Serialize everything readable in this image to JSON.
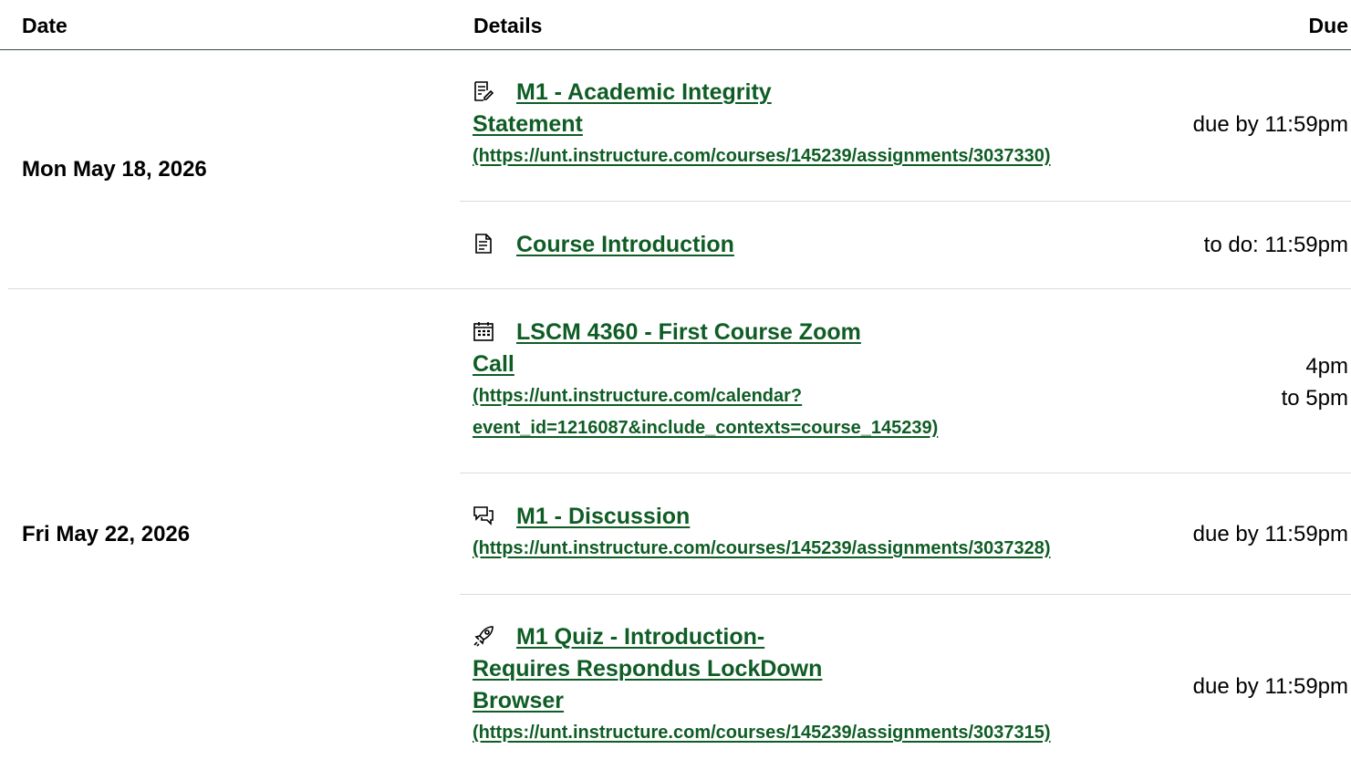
{
  "header": {
    "date": "Date",
    "details": "Details",
    "due": "Due"
  },
  "groups": [
    {
      "date": "Mon May 18, 2026"
    },
    {
      "date": "Fri May 22, 2026"
    }
  ],
  "items": [
    {
      "icon": "assignment-icon",
      "title_lines": [
        "M1 - Academic Integrity",
        "Statement"
      ],
      "url_lines": [
        "(https://unt.instructure.com/courses/145239/assignments/3037330)"
      ],
      "due": "due by 11:59pm"
    },
    {
      "icon": "page-icon",
      "title_lines": [
        "Course Introduction"
      ],
      "url_lines": [],
      "due": "to do: 11:59pm"
    },
    {
      "icon": "calendar-icon",
      "title_lines": [
        "LSCM 4360 - First Course Zoom",
        "Call"
      ],
      "url_lines": [
        "(https://unt.instructure.com/calendar?",
        "event_id=1216087&include_contexts=course_145239)"
      ],
      "due_lines": [
        "4pm",
        "to 5pm"
      ]
    },
    {
      "icon": "discussion-icon",
      "title_lines": [
        "M1 - Discussion"
      ],
      "url_lines": [
        "(https://unt.instructure.com/courses/145239/assignments/3037328)"
      ],
      "due": "due by 11:59pm"
    },
    {
      "icon": "quiz-rocket-icon",
      "title_lines": [
        "M1 Quiz - Introduction-",
        "Requires Respondus LockDown",
        "Browser"
      ],
      "url_lines": [
        "(https://unt.instructure.com/courses/145239/assignments/3037315)"
      ],
      "due": "due by 11:59pm"
    }
  ],
  "colors": {
    "link": "#0f5d25",
    "divider": "#d7dbe0",
    "header_border": "#3c4a4a"
  }
}
